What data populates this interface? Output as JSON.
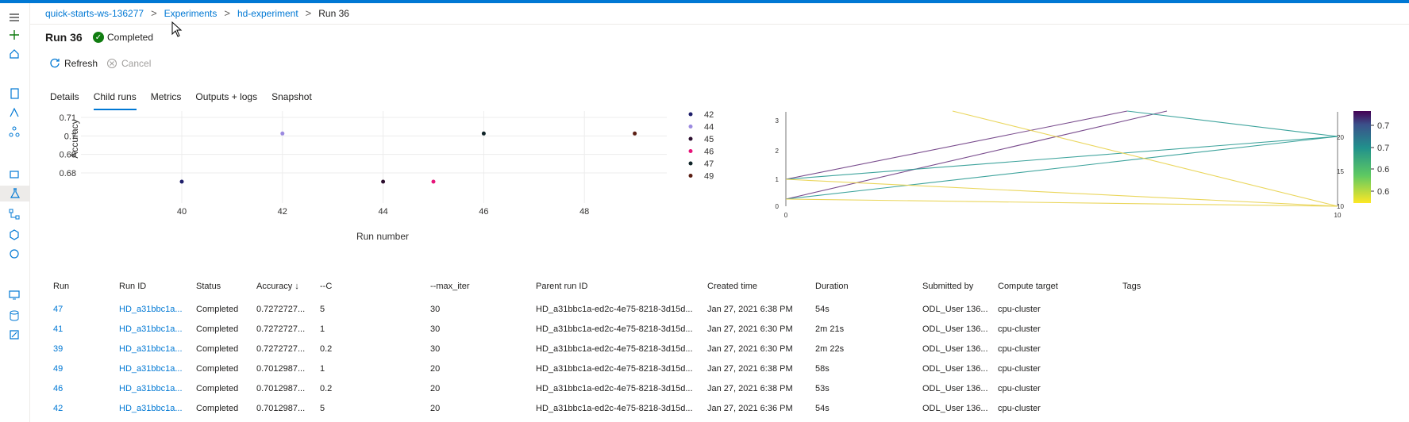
{
  "breadcrumb": {
    "items": [
      "quick-starts-ws-136277",
      "Experiments",
      "hd-experiment"
    ],
    "current": "Run 36",
    "separator": ">"
  },
  "run": {
    "title": "Run 36",
    "status": "Completed"
  },
  "toolbar": {
    "refresh_label": "Refresh",
    "cancel_label": "Cancel"
  },
  "tabs": [
    "Details",
    "Child runs",
    "Metrics",
    "Outputs + logs",
    "Snapshot"
  ],
  "colors": {
    "accent": "#0078d4",
    "success": "#107c10"
  },
  "chart_data": [
    {
      "type": "scatter",
      "xlabel": "Run number",
      "ylabel": "Accuracy",
      "xticks": [
        "40",
        "42",
        "44",
        "46",
        "48"
      ],
      "yticks": [
        "0.71",
        "0.7",
        "0.69",
        "0.68"
      ],
      "legend_position": "right",
      "legend": [
        "42",
        "44",
        "45",
        "46",
        "47",
        "49"
      ],
      "points": [
        {
          "x": 40,
          "y": 0.6753
        },
        {
          "x": 42,
          "y": 0.7013
        },
        {
          "x": 44,
          "y": 0.6753
        },
        {
          "x": 45,
          "y": 0.6753
        },
        {
          "x": 46,
          "y": 0.7013
        },
        {
          "x": 49,
          "y": 0.7013
        }
      ]
    },
    {
      "type": "line",
      "subtype": "parallel-coordinates",
      "left_axis_ticks": [
        "3",
        "2",
        "1",
        "0"
      ],
      "left_axis_bottom_label": "0",
      "right_axis_ticks": [
        "20",
        "15",
        "10"
      ],
      "right_axis_bottom_label": "10",
      "colorbar_ticks": [
        "0.71",
        "0.7",
        "0.69",
        "0.68"
      ],
      "colorscale": [
        "#fde725",
        "#5ec962",
        "#21918c",
        "#3b528b",
        "#440154"
      ]
    }
  ],
  "table": {
    "columns": [
      "Run",
      "Run ID",
      "Status",
      "Accuracy ↓",
      "--C",
      "--max_iter",
      "Parent run ID",
      "Created time",
      "Duration",
      "Submitted by",
      "Compute target",
      "Tags"
    ],
    "rows": [
      [
        "47",
        "HD_a31bbc1a...",
        "Completed",
        "0.7272727...",
        "5",
        "30",
        "HD_a31bbc1a-ed2c-4e75-8218-3d15d...",
        "Jan 27, 2021 6:38 PM",
        "54s",
        "ODL_User 136...",
        "cpu-cluster",
        ""
      ],
      [
        "41",
        "HD_a31bbc1a...",
        "Completed",
        "0.7272727...",
        "1",
        "30",
        "HD_a31bbc1a-ed2c-4e75-8218-3d15d...",
        "Jan 27, 2021 6:30 PM",
        "2m 21s",
        "ODL_User 136...",
        "cpu-cluster",
        ""
      ],
      [
        "39",
        "HD_a31bbc1a...",
        "Completed",
        "0.7272727...",
        "0.2",
        "30",
        "HD_a31bbc1a-ed2c-4e75-8218-3d15d...",
        "Jan 27, 2021 6:30 PM",
        "2m 22s",
        "ODL_User 136...",
        "cpu-cluster",
        ""
      ],
      [
        "49",
        "HD_a31bbc1a...",
        "Completed",
        "0.7012987...",
        "1",
        "20",
        "HD_a31bbc1a-ed2c-4e75-8218-3d15d...",
        "Jan 27, 2021 6:38 PM",
        "58s",
        "ODL_User 136...",
        "cpu-cluster",
        ""
      ],
      [
        "46",
        "HD_a31bbc1a...",
        "Completed",
        "0.7012987...",
        "0.2",
        "20",
        "HD_a31bbc1a-ed2c-4e75-8218-3d15d...",
        "Jan 27, 2021 6:38 PM",
        "53s",
        "ODL_User 136...",
        "cpu-cluster",
        ""
      ],
      [
        "42",
        "HD_a31bbc1a...",
        "Completed",
        "0.7012987...",
        "5",
        "20",
        "HD_a31bbc1a-ed2c-4e75-8218-3d15d...",
        "Jan 27, 2021 6:36 PM",
        "54s",
        "ODL_User 136...",
        "cpu-cluster",
        ""
      ]
    ]
  }
}
